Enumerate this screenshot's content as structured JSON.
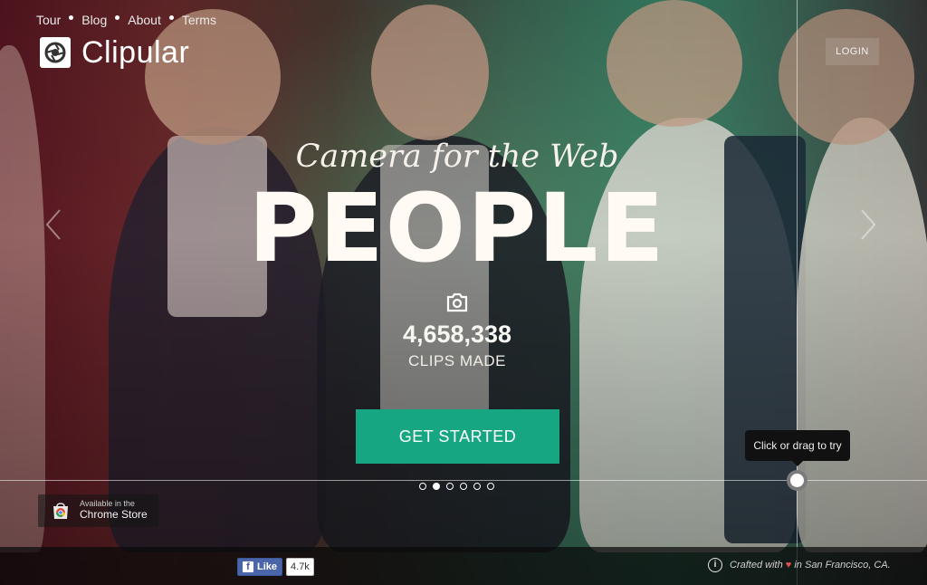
{
  "brand": {
    "name": "Clipular"
  },
  "header": {
    "login_label": "LOGIN"
  },
  "hero": {
    "tagline": "Camera for the Web",
    "headline": "PEOPLE",
    "clips_count": "4,658,338",
    "clips_label": "CLIPS MADE",
    "cta_label": "GET STARTED",
    "tooltip": "Click or drag to try",
    "carousel": {
      "total": 6,
      "active": 2
    }
  },
  "chrome_store": {
    "small": "Available in the",
    "big": "Chrome Store"
  },
  "footer": {
    "nav": [
      "Tour",
      "Blog",
      "About",
      "Terms"
    ],
    "fb_like": "Like",
    "fb_count": "4.7k",
    "credit_prefix": "Crafted with",
    "credit_suffix": "in San Francisco, CA."
  },
  "colors": {
    "accent": "#17a682",
    "facebook": "#4a66a8",
    "heart": "#e25050"
  },
  "icons": [
    "logo-aperture-icon",
    "camera-icon",
    "chevron-left-icon",
    "chevron-right-icon",
    "chrome-store-icon",
    "facebook-icon",
    "info-icon",
    "heart-icon"
  ]
}
